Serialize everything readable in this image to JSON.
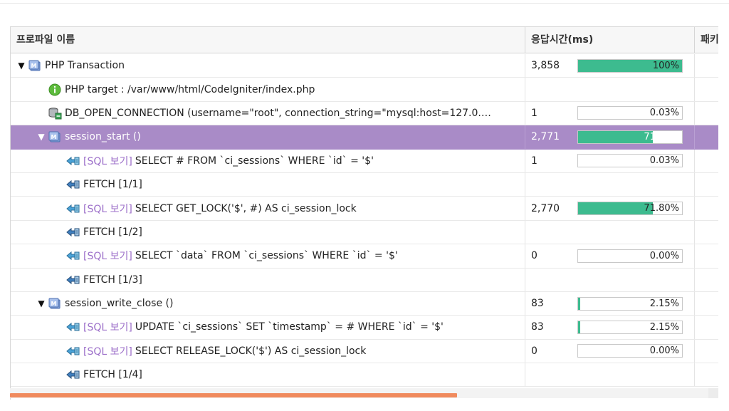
{
  "columns": {
    "name": "프로파일 이름",
    "response_time": "응답시간(ms)",
    "package": "패키"
  },
  "rows": [
    {
      "indent": 0,
      "toggle": "▼",
      "icon": "method-icon",
      "sql_tag": "",
      "label": "PHP Transaction",
      "value": "3,858",
      "percent": 100,
      "percent_text": "100%",
      "selected": false
    },
    {
      "indent": 1,
      "toggle": "",
      "icon": "info-icon",
      "sql_tag": "",
      "label": "PHP target : /var/www/html/CodeIgniter/index.php",
      "value": "",
      "percent": null,
      "percent_text": "",
      "selected": false
    },
    {
      "indent": 1,
      "toggle": "",
      "icon": "database-icon",
      "sql_tag": "",
      "label": "DB_OPEN_CONNECTION (username=\"root\", connection_string=\"mysql:host=127.0.…",
      "value": "1",
      "percent": 0.03,
      "percent_text": "0.03%",
      "selected": false
    },
    {
      "indent": 1,
      "toggle": "▼",
      "icon": "method-icon",
      "sql_tag": "",
      "label": "session_start ()",
      "value": "2,771",
      "percent": 71.82,
      "percent_text": "71.82%",
      "selected": true
    },
    {
      "indent": 2,
      "toggle": "",
      "icon": "sql-icon",
      "sql_tag": "[SQL 보기]",
      "label": "SELECT # FROM `ci_sessions` WHERE `id` = '$'",
      "value": "1",
      "percent": 0.03,
      "percent_text": "0.03%",
      "selected": false
    },
    {
      "indent": 2,
      "toggle": "",
      "icon": "fetch-icon",
      "sql_tag": "",
      "label": "FETCH [1/1]",
      "value": "",
      "percent": null,
      "percent_text": "",
      "selected": false
    },
    {
      "indent": 2,
      "toggle": "",
      "icon": "sql-icon",
      "sql_tag": "[SQL 보기]",
      "label": "SELECT GET_LOCK('$', #) AS ci_session_lock",
      "value": "2,770",
      "percent": 71.8,
      "percent_text": "71.80%",
      "selected": false
    },
    {
      "indent": 2,
      "toggle": "",
      "icon": "fetch-icon",
      "sql_tag": "",
      "label": "FETCH [1/2]",
      "value": "",
      "percent": null,
      "percent_text": "",
      "selected": false
    },
    {
      "indent": 2,
      "toggle": "",
      "icon": "sql-icon",
      "sql_tag": "[SQL 보기]",
      "label": "SELECT `data` FROM `ci_sessions` WHERE `id` = '$'",
      "value": "0",
      "percent": 0.0,
      "percent_text": "0.00%",
      "selected": false
    },
    {
      "indent": 2,
      "toggle": "",
      "icon": "fetch-icon",
      "sql_tag": "",
      "label": "FETCH [1/3]",
      "value": "",
      "percent": null,
      "percent_text": "",
      "selected": false
    },
    {
      "indent": 1,
      "toggle": "▼",
      "icon": "method-icon",
      "sql_tag": "",
      "label": "session_write_close ()",
      "value": "83",
      "percent": 2.15,
      "percent_text": "2.15%",
      "selected": false
    },
    {
      "indent": 2,
      "toggle": "",
      "icon": "sql-icon",
      "sql_tag": "[SQL 보기]",
      "label": "UPDATE `ci_sessions` SET `timestamp` = # WHERE `id` = '$'",
      "value": "83",
      "percent": 2.15,
      "percent_text": "2.15%",
      "selected": false
    },
    {
      "indent": 2,
      "toggle": "",
      "icon": "sql-icon",
      "sql_tag": "[SQL 보기]",
      "label": "SELECT RELEASE_LOCK('$') AS ci_session_lock",
      "value": "0",
      "percent": 0.0,
      "percent_text": "0.00%",
      "selected": false
    },
    {
      "indent": 2,
      "toggle": "",
      "icon": "fetch-icon",
      "sql_tag": "",
      "label": "FETCH [1/4]",
      "value": "",
      "percent": null,
      "percent_text": "",
      "selected": false
    }
  ],
  "colors": {
    "bar_fill": "#3dbb8f",
    "selected_row": "#a98bc7",
    "sql_tag": "#9c6fc9",
    "scroll_thumb": "#f08a5d"
  },
  "scrollbar": {
    "position_fraction": 0,
    "visible_fraction": 0.64
  }
}
